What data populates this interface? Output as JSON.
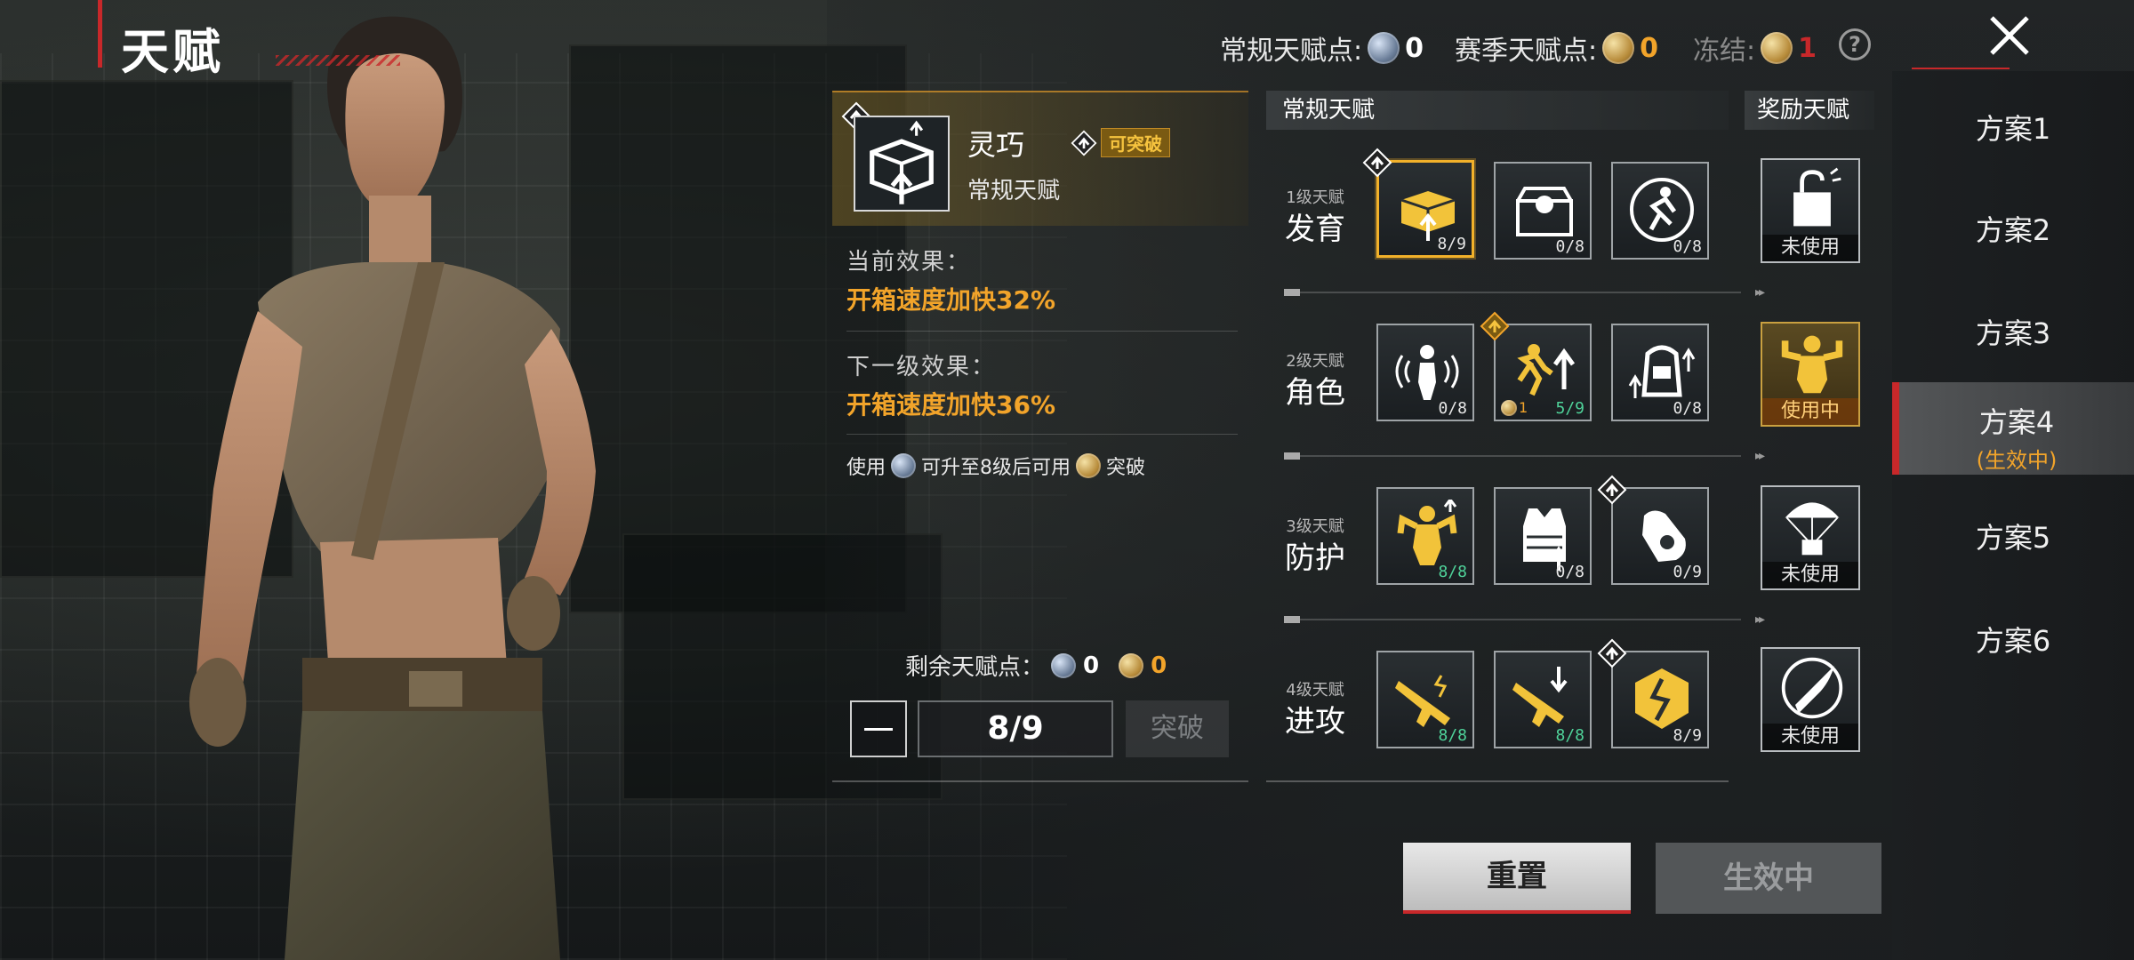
{
  "page": {
    "title": "天赋"
  },
  "currency": {
    "regular_label": "常规天赋点:",
    "regular_value": "0",
    "season_label": "赛季天赋点:",
    "season_value": "0",
    "frozen_label": "冻结:",
    "frozen_value": "1",
    "help": "?"
  },
  "plans": [
    {
      "label": "方案1"
    },
    {
      "label": "方案2"
    },
    {
      "label": "方案3"
    },
    {
      "label": "方案4",
      "sub": "(生效中)"
    },
    {
      "label": "方案5"
    },
    {
      "label": "方案6"
    }
  ],
  "detail": {
    "name": "灵巧",
    "breakable_tag": "可突破",
    "type": "常规天赋",
    "current_label": "当前效果：",
    "current_value": "开箱速度加快32%",
    "next_label": "下一级效果：",
    "next_value": "开箱速度加快36%",
    "hint_pre": "使用",
    "hint_mid": "可升至8级后可用",
    "hint_post": "突破",
    "remain_label": "剩余天赋点：",
    "remain_silver": "0",
    "remain_gold": "0",
    "level": "8/9",
    "break_button": "突破"
  },
  "grid": {
    "regular_header": "常规天赋",
    "reward_header": "奖励天赋",
    "rows": [
      {
        "level": "1级天赋",
        "name": "发育",
        "nodes": [
          {
            "icon": "supply-box-icon",
            "count": "8/9",
            "green": false
          },
          {
            "icon": "loot-crate-icon",
            "count": "0/8",
            "green": false
          },
          {
            "icon": "sprint-icon",
            "count": "0/8",
            "green": false
          }
        ]
      },
      {
        "level": "2级天赋",
        "name": "角色",
        "nodes": [
          {
            "icon": "sound-soldier-icon",
            "count": "0/8",
            "green": false
          },
          {
            "icon": "runner-up-icon",
            "count": "5/9",
            "green": true,
            "mini": "1"
          },
          {
            "icon": "backpack-up-icon",
            "count": "0/8",
            "green": false
          }
        ]
      },
      {
        "level": "3级天赋",
        "name": "防护",
        "nodes": [
          {
            "icon": "strength-icon",
            "count": "8/8",
            "green": true
          },
          {
            "icon": "vest-icon",
            "count": "0/8",
            "green": false
          },
          {
            "icon": "glove-icon",
            "count": "0/9",
            "green": false
          }
        ]
      },
      {
        "level": "4级天赋",
        "name": "进攻",
        "nodes": [
          {
            "icon": "rifle-icon",
            "count": "8/8",
            "green": true
          },
          {
            "icon": "rifle-down-icon",
            "count": "8/8",
            "green": true
          },
          {
            "icon": "shield-break-icon",
            "count": "8/9",
            "green": false
          }
        ]
      }
    ],
    "rewards": [
      {
        "icon": "unlock-bag-icon",
        "state": "未使用"
      },
      {
        "icon": "muscle-icon",
        "state": "使用中"
      },
      {
        "icon": "parachute-icon",
        "state": "未使用"
      },
      {
        "icon": "bullet-icon",
        "state": "未使用"
      }
    ]
  },
  "buttons": {
    "reset": "重置",
    "active": "生效中"
  },
  "colors": {
    "accent": "#c8282a",
    "gold": "#f2a42a",
    "green": "#4fd39a"
  }
}
